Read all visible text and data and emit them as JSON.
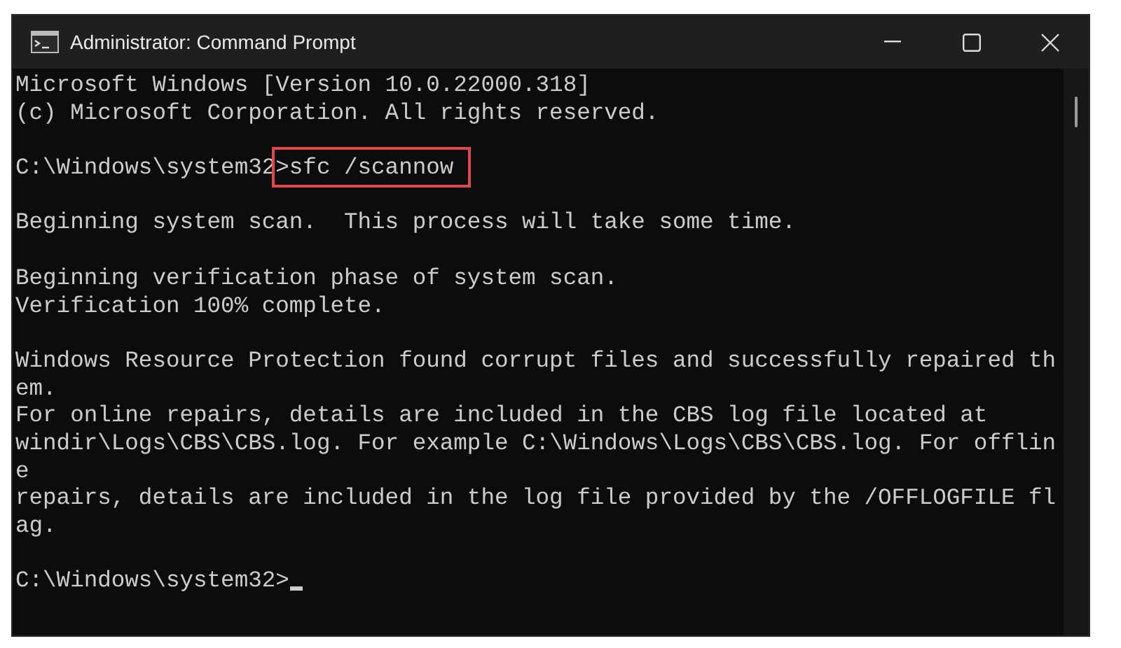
{
  "window": {
    "title": "Administrator: Command Prompt"
  },
  "console": {
    "lines": [
      {
        "kind": "text",
        "text": "Microsoft Windows [Version 10.0.22000.318]"
      },
      {
        "kind": "text",
        "text": "(c) Microsoft Corporation. All rights reserved."
      },
      {
        "kind": "blank"
      },
      {
        "kind": "prompt",
        "prompt": "C:\\Windows\\system32",
        "command": ">sfc /scannow",
        "highlighted": true,
        "cursor": false
      },
      {
        "kind": "blank"
      },
      {
        "kind": "text",
        "text": "Beginning system scan.  This process will take some time."
      },
      {
        "kind": "blank"
      },
      {
        "kind": "text",
        "text": "Beginning verification phase of system scan."
      },
      {
        "kind": "text",
        "text": "Verification 100% complete."
      },
      {
        "kind": "blank"
      },
      {
        "kind": "text",
        "text": "Windows Resource Protection found corrupt files and successfully repaired th"
      },
      {
        "kind": "text",
        "text": "em."
      },
      {
        "kind": "text",
        "text": "For online repairs, details are included in the CBS log file located at"
      },
      {
        "kind": "text",
        "text": "windir\\Logs\\CBS\\CBS.log. For example C:\\Windows\\Logs\\CBS\\CBS.log. For offlin"
      },
      {
        "kind": "text",
        "text": "e"
      },
      {
        "kind": "text",
        "text": "repairs, details are included in the log file provided by the /OFFLOGFILE fl"
      },
      {
        "kind": "text",
        "text": "ag."
      },
      {
        "kind": "blank"
      },
      {
        "kind": "prompt",
        "prompt": "C:\\Windows\\system32>",
        "highlighted": false,
        "cursor": true
      }
    ]
  }
}
